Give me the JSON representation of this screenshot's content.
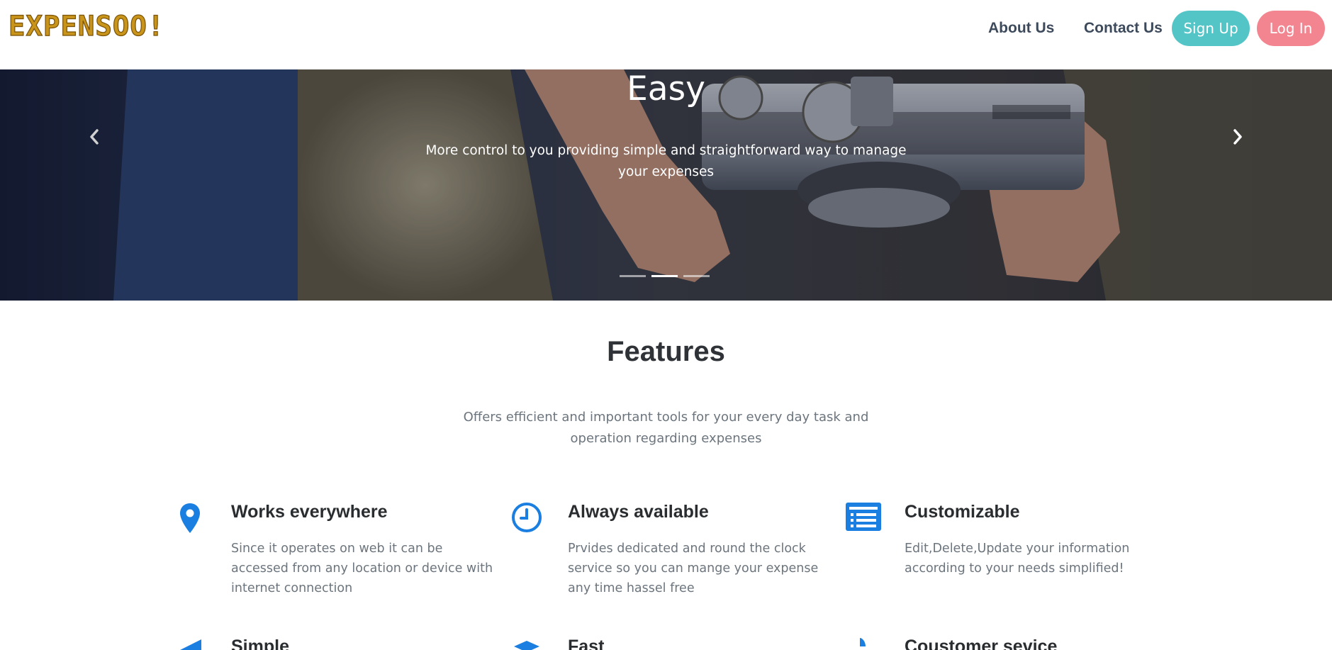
{
  "brand": {
    "logo_text": "EXPENSOO!",
    "logo_color": "#c8941a"
  },
  "nav": {
    "about": "About Us",
    "contact": "Contact Us",
    "signup": "Sign Up",
    "login": "Log In",
    "signup_color": "#54c5c6",
    "login_color": "#f38591"
  },
  "hero": {
    "title": "Easy",
    "subtitle": "More control to you providing simple and straightforward way to manage your expenses",
    "prev_icon": "chevron-left-icon",
    "next_icon": "chevron-right-icon",
    "slide_count": 3,
    "active_slide": 2
  },
  "features": {
    "heading": "Features",
    "lead": "Offers efficient and important tools for your every day task and operation regarding expenses",
    "accent_color": "#1a7fe0",
    "items": [
      {
        "icon": "map-pin-icon",
        "title": "Works everywhere",
        "desc": "Since it operates on web it can be accessed from any location or device with internet connection"
      },
      {
        "icon": "clock-icon",
        "title": "Always available",
        "desc": "Prvides dedicated and round the clock service so you can mange your expense any time hassel free"
      },
      {
        "icon": "list-icon",
        "title": "Customizable",
        "desc": "Edit,Delete,Update your information according to your needs simplified!"
      },
      {
        "icon": "megaphone-icon",
        "title": "Simple",
        "desc": ""
      },
      {
        "icon": "plane-icon",
        "title": "Fast",
        "desc": ""
      },
      {
        "icon": "phone-icon",
        "title": "Coustomer sevice",
        "desc": ""
      }
    ]
  }
}
